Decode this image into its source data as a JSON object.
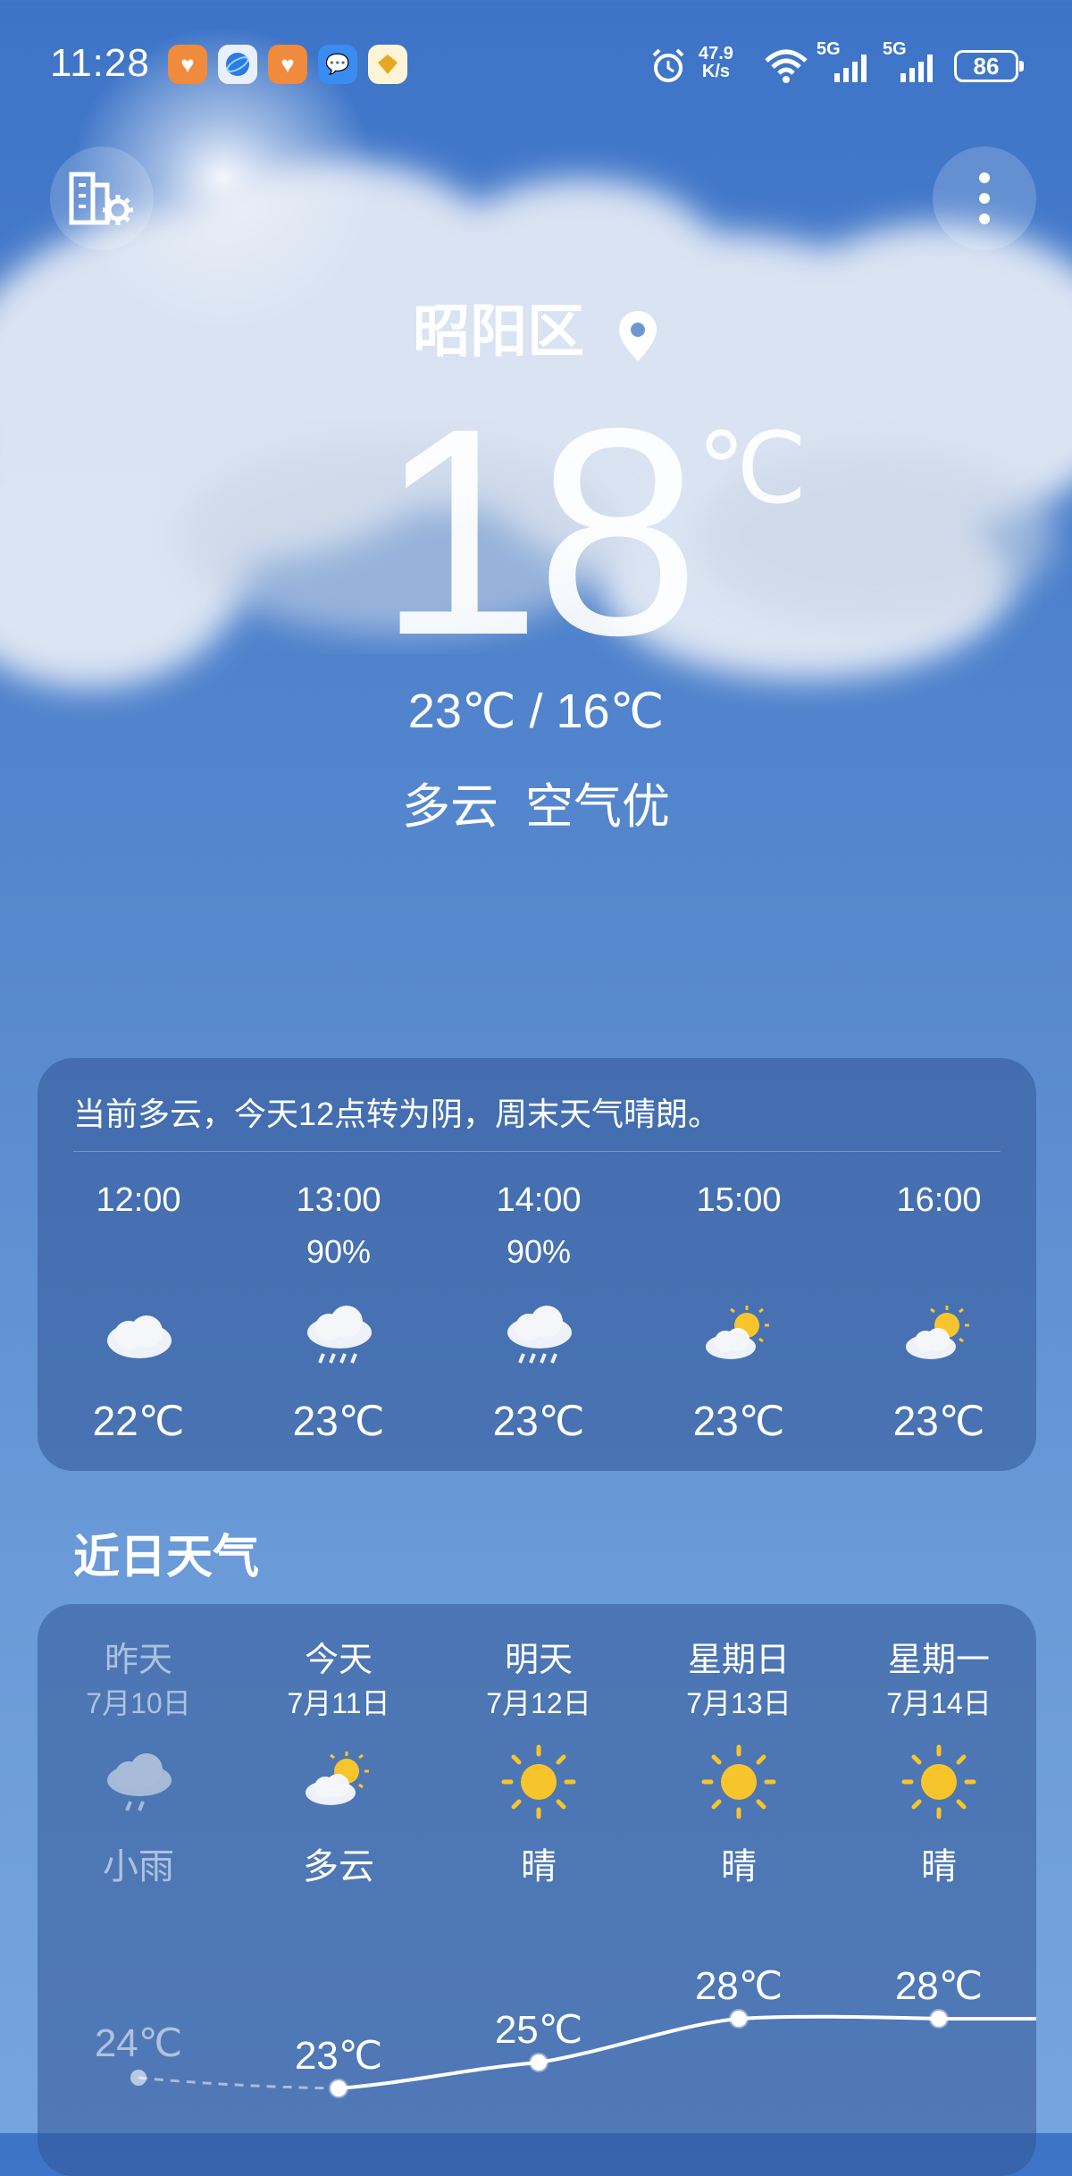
{
  "status_bar": {
    "time": "11:28",
    "net_speed_value": "47.9",
    "net_speed_unit": "K/s",
    "network_1": "5G",
    "network_2": "5G",
    "battery": "86"
  },
  "header": {
    "location": "昭阳区",
    "current_temp": "18",
    "temp_unit": "℃",
    "high_low": "23℃ / 16℃",
    "condition": "多云  空气优"
  },
  "hourly": {
    "summary": "当前多云，今天12点转为阴，周末天气晴朗。",
    "items": [
      {
        "time": "12:00",
        "precip": "",
        "icon": "cloudy-icon",
        "temp": "22℃"
      },
      {
        "time": "13:00",
        "precip": "90%",
        "icon": "rain-cloud-icon",
        "temp": "23℃"
      },
      {
        "time": "14:00",
        "precip": "90%",
        "icon": "rain-cloud-icon",
        "temp": "23℃"
      },
      {
        "time": "15:00",
        "precip": "",
        "icon": "partly-sunny-icon",
        "temp": "23℃"
      },
      {
        "time": "16:00",
        "precip": "",
        "icon": "partly-sunny-icon",
        "temp": "23℃"
      }
    ]
  },
  "daily": {
    "title": "近日天气",
    "days": [
      {
        "name": "昨天",
        "date": "7月10日",
        "icon": "light-rain-icon",
        "condition": "小雨",
        "high": "24℃"
      },
      {
        "name": "今天",
        "date": "7月11日",
        "icon": "partly-sunny-icon",
        "condition": "多云",
        "high": "23℃"
      },
      {
        "name": "明天",
        "date": "7月12日",
        "icon": "sun-icon",
        "condition": "晴",
        "high": "25℃"
      },
      {
        "name": "星期日",
        "date": "7月13日",
        "icon": "sun-icon",
        "condition": "晴",
        "high": "28℃"
      },
      {
        "name": "星期一",
        "date": "7月14日",
        "icon": "sun-icon",
        "condition": "晴",
        "high": "28℃"
      }
    ]
  },
  "colors": {
    "sky_top": "#3d74c8",
    "sky_bottom": "#76a4de",
    "card": "#325596",
    "sun": "#f7c52b"
  }
}
